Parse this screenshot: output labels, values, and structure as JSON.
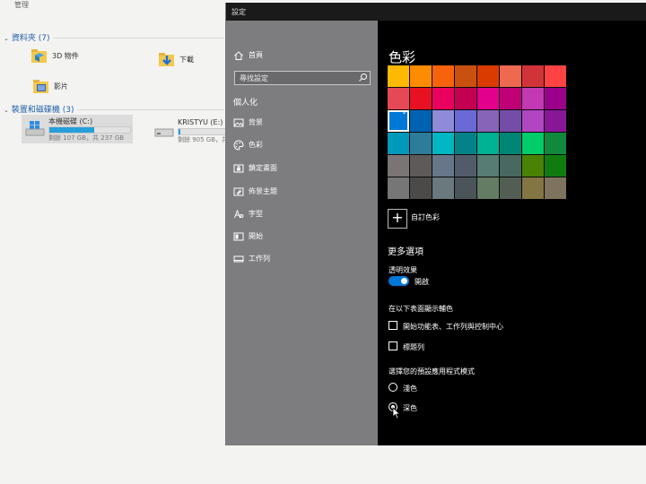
{
  "explorer": {
    "top_label": "管理",
    "groups": [
      {
        "label": "資料夾 (7)"
      },
      {
        "label": "裝置和磁碟機 (3)"
      }
    ],
    "folders": [
      {
        "label": "3D 物件",
        "icon": "3d-objects-folder-icon"
      },
      {
        "label": "下載",
        "icon": "downloads-folder-icon"
      },
      {
        "label": "影片",
        "icon": "videos-folder-icon"
      }
    ],
    "drives": [
      {
        "name": "本機磁碟 (C:)",
        "space": "剩餘 107 GB，共 237 GB",
        "used_fraction": 0.55,
        "icon": "windows-drive-icon"
      },
      {
        "name": "KRISTYU (E:)",
        "space": "剩餘 905 GB，共",
        "used_fraction": 0.03,
        "icon": "usb-drive-icon"
      }
    ]
  },
  "settings": {
    "window_title": "設定",
    "sidebar": {
      "home": "首頁",
      "search_placeholder": "尋找設定",
      "section": "個人化",
      "items": [
        {
          "label": "背景",
          "icon": "image-icon"
        },
        {
          "label": "色彩",
          "icon": "palette-icon",
          "active": true
        },
        {
          "label": "鎖定畫面",
          "icon": "lock-screen-icon"
        },
        {
          "label": "佈景主題",
          "icon": "themes-icon"
        },
        {
          "label": "字型",
          "icon": "font-icon"
        },
        {
          "label": "開始",
          "icon": "start-icon"
        },
        {
          "label": "工作列",
          "icon": "taskbar-icon"
        }
      ]
    },
    "content": {
      "heading": "色彩",
      "swatches": [
        "#ffb900",
        "#ff8c00",
        "#f7630c",
        "#ca5010",
        "#da3b01",
        "#ef6950",
        "#d13438",
        "#ff4343",
        "#e74856",
        "#e81123",
        "#ea005e",
        "#c30052",
        "#e3008c",
        "#bf0077",
        "#c239b3",
        "#9a0089",
        "#0078d7",
        "#0063b1",
        "#8e8cd8",
        "#6b69d6",
        "#8764b8",
        "#744da9",
        "#b146c2",
        "#881798",
        "#0099bc",
        "#2d7d9a",
        "#00b7c3",
        "#038387",
        "#00b294",
        "#018574",
        "#00cc6a",
        "#10893e",
        "#7a7574",
        "#5d5a58",
        "#68768a",
        "#515c6b",
        "#567c73",
        "#486860",
        "#498205",
        "#107c10",
        "#767676",
        "#4c4a48",
        "#69797e",
        "#4a5459",
        "#647c64",
        "#525e54",
        "#847545",
        "#7e735f"
      ],
      "selected_swatch_index": 16,
      "custom_color_label": "自訂色彩",
      "more_options": "更多選項",
      "transparency_label": "透明效果",
      "transparency_value": "開啟",
      "transparency_on": true,
      "accent_surfaces_label": "在以下表面顯示輔色",
      "checkboxes": [
        {
          "label": "開始功能表、工作列與控制中心",
          "checked": false
        },
        {
          "label": "標題列",
          "checked": false
        }
      ],
      "app_mode_label": "選擇您的預設應用程式模式",
      "app_modes": [
        {
          "label": "淺色",
          "selected": false
        },
        {
          "label": "深色",
          "selected": true
        }
      ]
    }
  }
}
